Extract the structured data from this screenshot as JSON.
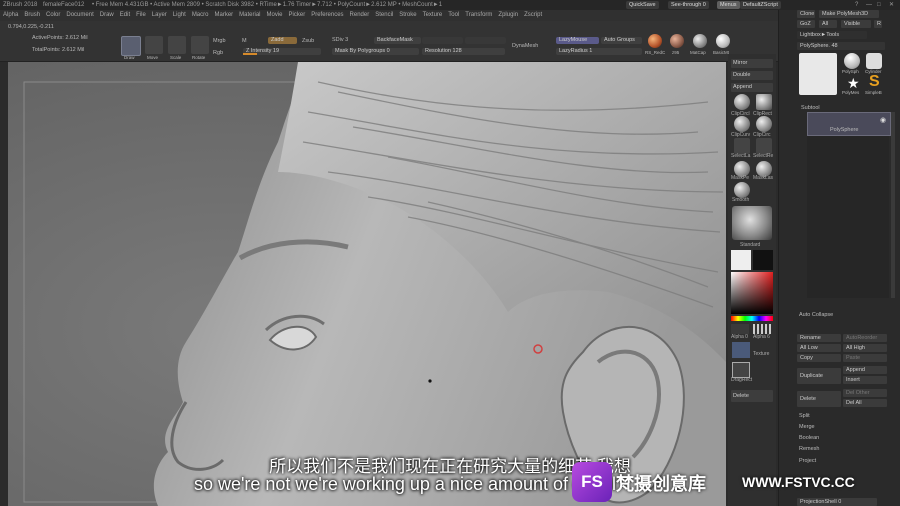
{
  "titlebar": {
    "app": "ZBrush 2018",
    "file": "femaleFace012",
    "stats": "• Free Mem 4.431GB • Active Mem 2809 • Scratch Disk 3982 • RTime►1.76 Timer►7.712 • PolyCount►2.612 MP • MeshCount►1",
    "quicksave": "QuickSave",
    "seethrough": "See-through 0",
    "menus": "Menus",
    "script": "DefaultZScript"
  },
  "menubar": [
    "Alpha",
    "Brush",
    "Color",
    "Document",
    "Draw",
    "Edit",
    "File",
    "Layer",
    "Light",
    "Macro",
    "Marker",
    "Material",
    "Movie",
    "Picker",
    "Preferences",
    "Render",
    "Stencil",
    "Stroke",
    "Texture",
    "Tool",
    "Transform",
    "Zplugin",
    "Zscript"
  ],
  "toolstrip": {
    "coords": "0.794,0.225,-0.211",
    "active_points": "ActivePoints: 2.612 Mil",
    "total_points": "TotalPoints: 2.612 Mil",
    "draw": "Draw",
    "move": "Move",
    "scale": "Scale",
    "rotate": "Rotate",
    "mrgb": "Mrgb",
    "rgb": "Rgb",
    "m": "M",
    "zadd": "Zadd",
    "zsub": "Zsub",
    "z_intensity": "Z Intensity 19",
    "sdiv": "SDiv 3",
    "backface": "BackfaceMask",
    "mask_by_poly": "Mask By Polygroups 0",
    "resolution": "Resolution 128",
    "dynamesh": "DynaMesh",
    "lazymouse": "LazyMouse",
    "lazyradius": "LazyRadius 1",
    "autogroups": "Auto Groups",
    "materials": [
      "RS_RedC",
      "z95",
      "MatCap",
      "BasicMt"
    ]
  },
  "shelf": {
    "mirror": "Mirror",
    "double": "Double",
    "append": "Append",
    "clip_labels": [
      "ClipCircl",
      "ClipRect",
      "ClipCurv",
      "ClipCirc"
    ],
    "select_labels": [
      "SelectLa",
      "SelectRe"
    ],
    "mask_labels": [
      "MaskPe",
      "MaskLas"
    ],
    "smooth": "Smooth",
    "standard": "Standard",
    "alpha": "Alpha 0",
    "alpha2": "Alpha 6",
    "texture": "Texture",
    "dragrect": "DragRect",
    "delete": "Delete"
  },
  "tray": {
    "clone": "Clone",
    "make_polymesh": "Make PolyMesh3D",
    "goz": "GoZ",
    "all": "All",
    "visible": "Visible",
    "r": "R",
    "lightbox_tools": "Lightbox►Tools",
    "polysphere": "PolySphere. 48",
    "tool_names": [
      "PolySph",
      "Cylinder",
      "PolyMes",
      "SimpleB"
    ],
    "subtool": "Subtool",
    "subtool_item": "PolySphere",
    "auto_collapse": "Auto Collapse",
    "rename": "Rename",
    "autoreorder": "AutoReorder",
    "all_low": "All Low",
    "all_high": "All High",
    "copy": "Copy",
    "paste": "Paste",
    "duplicate": "Duplicate",
    "append": "Append",
    "insert": "Insert",
    "delete": "Delete",
    "del_other": "Del Other",
    "del_all": "Del All",
    "split": "Split",
    "merge": "Merge",
    "boolean": "Boolean",
    "remesh": "Remesh",
    "project": "Project",
    "projection_shell": "ProjectionShell 0"
  },
  "subtitles": {
    "cn": "所以我们不是我们现在正在研究大量的细节 我想",
    "en": "so we're not we're working up a nice amount of detail"
  },
  "watermark": {
    "logo": "FS",
    "name": "梵摄创意库",
    "url": "WWW.FSTVC.CC"
  },
  "colors": {
    "accent": "#d68a2a",
    "clay": "#9a9a9a",
    "watermark": "#9b3fd6"
  }
}
